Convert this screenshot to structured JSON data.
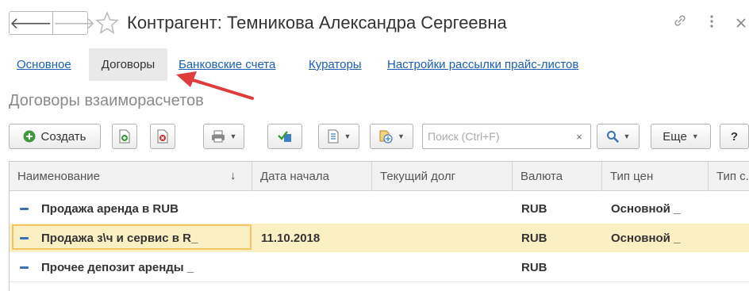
{
  "header": {
    "back_icon": "arrow-left-icon",
    "forward_icon": "arrow-right-icon",
    "favorite_icon": "star-icon",
    "title": "Контрагент: Темникова Александра Сергеевна",
    "link_icon": "link-icon",
    "more_icon": "more-vertical-icon",
    "close_icon": "close-icon"
  },
  "tabs": [
    {
      "label": "Основное",
      "active": false
    },
    {
      "label": "Договоры",
      "active": true
    },
    {
      "label": "Банковские счета",
      "active": false
    },
    {
      "label": "Кураторы",
      "active": false
    },
    {
      "label": "Настройки рассылки прайс-листов",
      "active": false
    }
  ],
  "section_title": "Договоры взаиморасчетов",
  "toolbar": {
    "create_label": "Создать",
    "search_placeholder": "Поиск (Ctrl+F)",
    "search_clear": "×",
    "more_label": "Еще",
    "help_label": "?"
  },
  "table": {
    "columns": [
      "Наименование",
      "Дата начала",
      "Текущий долг",
      "Валюта",
      "Тип цен",
      "Тип с..."
    ],
    "sort_indicator": "↓",
    "rows": [
      {
        "name": "Продажа аренда в RUB",
        "start_date": "",
        "debt": "",
        "currency": "RUB",
        "price_type": "Основной _",
        "type_s": "",
        "selected": false
      },
      {
        "name": "Продажа з\\ч и сервис в R_",
        "start_date": "11.10.2018",
        "debt": "",
        "currency": "RUB",
        "price_type": "Основной _",
        "type_s": "",
        "selected": true
      },
      {
        "name": "Прочее депозит аренды _",
        "start_date": "",
        "debt": "",
        "currency": "RUB",
        "price_type": "",
        "type_s": "",
        "selected": false
      }
    ]
  },
  "colors": {
    "link": "#1a5fb4",
    "selected_row": "#fbf0c4",
    "selected_border": "#f2c464",
    "annotation_arrow": "#e03c3c",
    "create_icon": "#3c9a3c",
    "delete_icon": "#cc2b2b"
  }
}
